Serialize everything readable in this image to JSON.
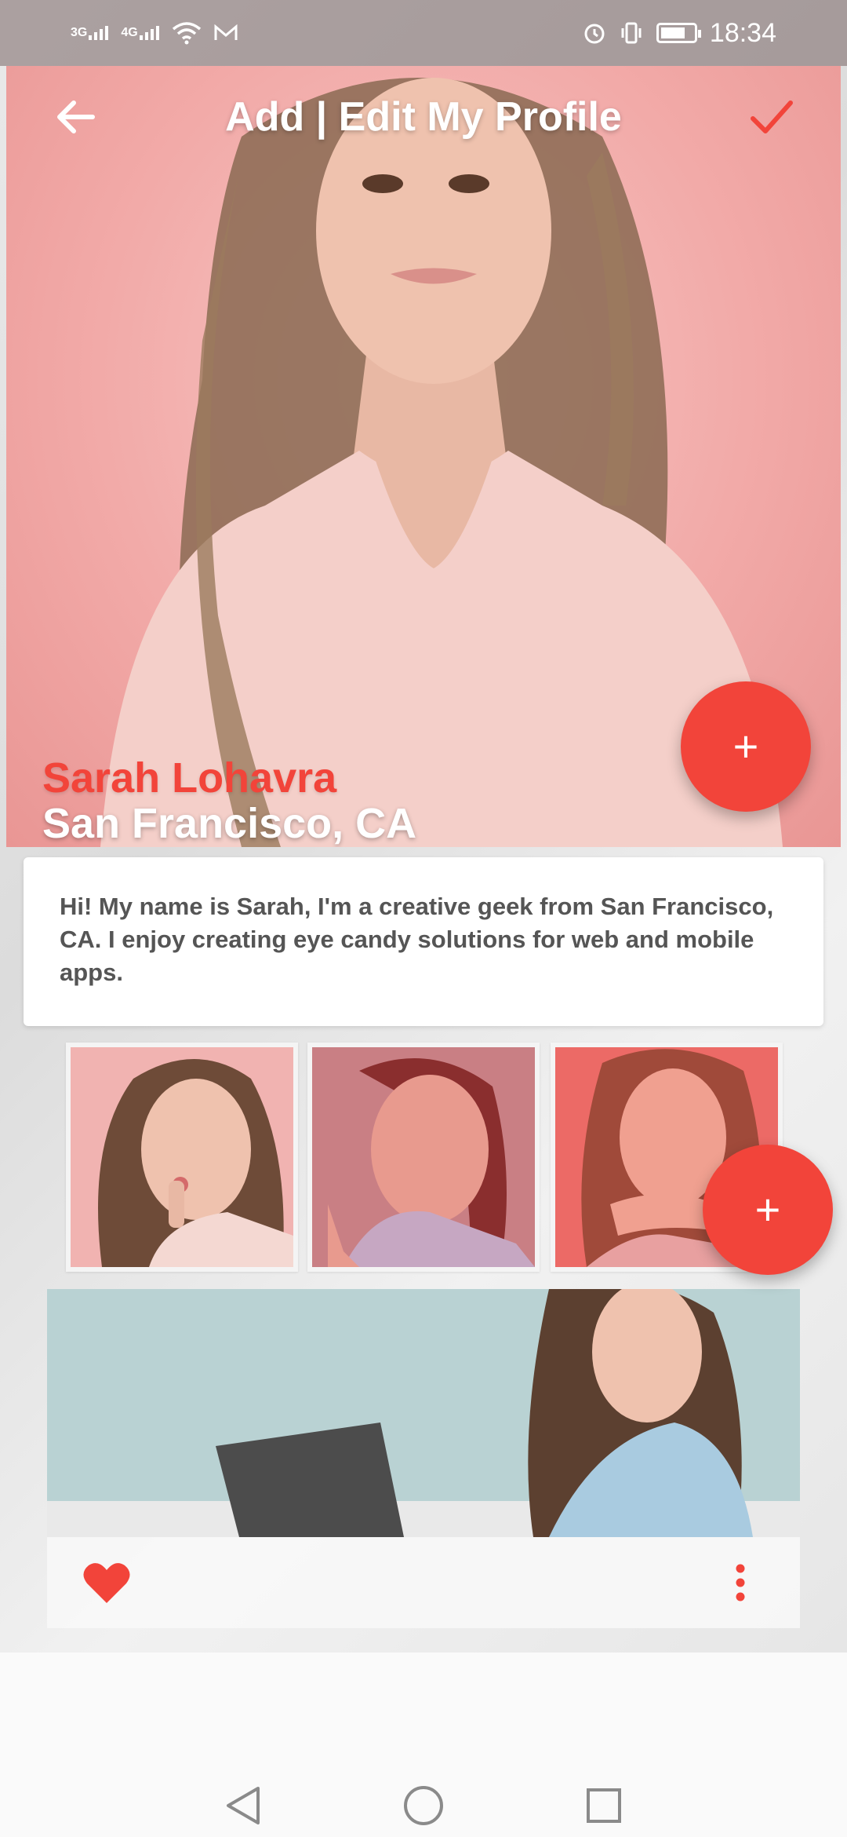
{
  "status_bar": {
    "net1": "3G",
    "net2": "4G",
    "time": "18:34"
  },
  "header": {
    "title": "Add | Edit My Profile"
  },
  "profile": {
    "name": "Sarah Lohavra",
    "location": "San Francisco, CA",
    "bio": "Hi! My name is Sarah, I'm a creative geek from San Francisco, CA. I enjoy creating eye candy solutions for web and mobile apps."
  },
  "fabs": {
    "add_label": "+"
  },
  "colors": {
    "accent": "#f2443a",
    "hero_bg": "#f2aaa8",
    "card_bg": "#ffffff",
    "text_secondary": "#555555"
  },
  "icons": {
    "back": "arrow-left-icon",
    "save": "check-icon",
    "like": "heart-icon",
    "more": "more-vertical-icon"
  }
}
